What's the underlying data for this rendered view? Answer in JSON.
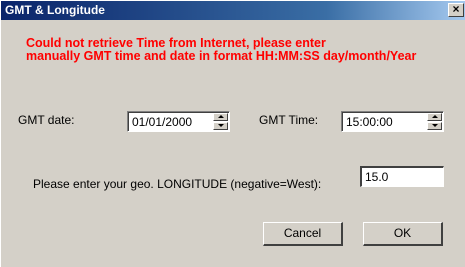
{
  "window": {
    "title": "GMT & Longitude",
    "close_glyph": "×"
  },
  "message": {
    "line1": "Could not retrieve Time from Internet, please enter",
    "line2": "manually GMT time and date in format HH:MM:SS day/month/Year"
  },
  "gmt_date": {
    "label": "GMT date:",
    "value": "01/01/2000"
  },
  "gmt_time": {
    "label": "GMT Time:",
    "value": "15:00:00"
  },
  "longitude": {
    "label": "Please enter your geo. LONGITUDE (negative=West):",
    "value": "15.0"
  },
  "buttons": {
    "cancel": "Cancel",
    "ok": "OK"
  },
  "colors": {
    "titlebar": "#0a246a",
    "dialog_bg": "#d4d0c8",
    "error_text": "#ff0000"
  },
  "icons": {
    "close": "close-icon",
    "spin_up": "spin-up-arrow-icon",
    "spin_down": "spin-down-arrow-icon"
  }
}
